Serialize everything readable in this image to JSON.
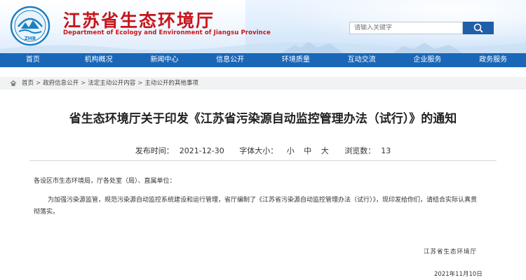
{
  "header": {
    "logo_text": "ZHB",
    "title": "江苏省生态环境厅",
    "subtitle": "Department of Ecology and Environment of Jiangsu Province",
    "search_placeholder": "请输入关键字",
    "search_icon": "search-icon"
  },
  "nav": {
    "items": [
      {
        "label": "首页"
      },
      {
        "label": "机构概况"
      },
      {
        "label": "新闻中心"
      },
      {
        "label": "信息公开"
      },
      {
        "label": "环境质量"
      },
      {
        "label": "互动交流"
      },
      {
        "label": "企业服务"
      },
      {
        "label": "政务服务"
      }
    ],
    "background": "#1a67b8"
  },
  "breadcrumb": {
    "items": [
      {
        "label": "首页"
      },
      {
        "label": "政府信息公开"
      },
      {
        "label": "法定主动公开内容"
      },
      {
        "label": "主动公开的其他事项"
      }
    ],
    "separator": ">"
  },
  "article": {
    "title": "省生态环境厅关于印发《江苏省污染源自动监控管理办法（试行）》的通知",
    "publish_label": "发布时间：",
    "publish_date": "2021-12-30",
    "font_size_label": "字体大小：",
    "font_small": "小",
    "font_medium": "中",
    "font_large": "大",
    "views_label": "浏览数：",
    "views": "13",
    "salutation": "各设区市生态环境局，厅各处室（局）、直属单位：",
    "body": "为加强污染源监管，规范污染源自动监控系统建设和运行管理，省厅编制了《江苏省污染源自动监控管理办法（试行）》，现印发给你们，请结合实际认真贯彻落实。",
    "signature_org": "江苏省生态环境厅",
    "signature_date": "2021年11月10日"
  },
  "colors": {
    "brand_red": "#c8151b",
    "nav_blue": "#1a67b8",
    "search_button": "#1f5faa"
  }
}
